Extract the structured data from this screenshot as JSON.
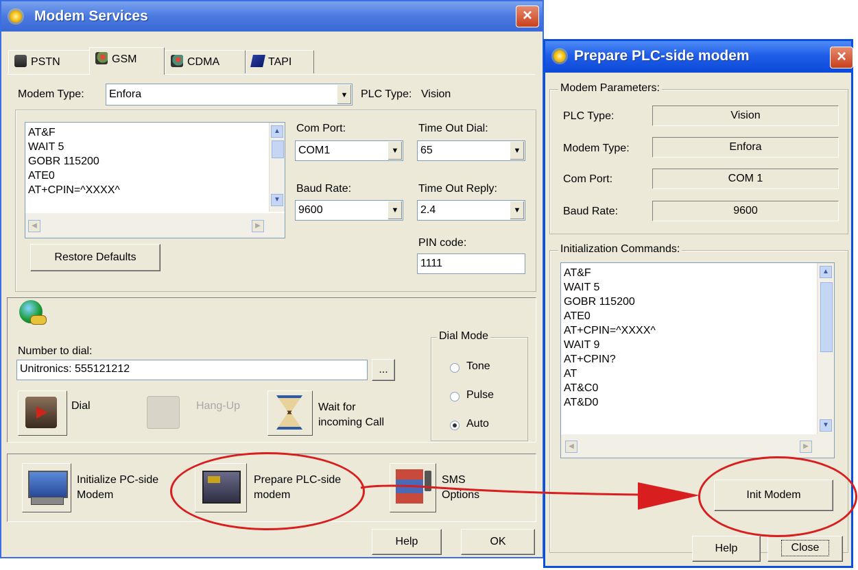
{
  "modem_services": {
    "title": "Modem Services",
    "close_glyph": "×",
    "tabs": [
      {
        "label": "PSTN"
      },
      {
        "label": "GSM"
      },
      {
        "label": "CDMA"
      },
      {
        "label": "TAPI"
      }
    ],
    "modem_type_label": "Modem Type:",
    "modem_type_value": "Enfora",
    "plc_type_label": "PLC Type:",
    "plc_type_value": "Vision",
    "init_commands": [
      "AT&F",
      "WAIT 5",
      "GOBR 115200",
      "ATE0",
      "AT+CPIN=^XXXX^"
    ],
    "com_port_label": "Com Port:",
    "com_port_value": "COM1",
    "time_out_dial_label": "Time Out Dial:",
    "time_out_dial_value": "65",
    "baud_rate_label": "Baud Rate:",
    "baud_rate_value": "9600",
    "time_out_reply_label": "Time Out Reply:",
    "time_out_reply_value": "2.4",
    "pin_code_label": "PIN code:",
    "pin_code_value": "1111",
    "restore_defaults_label": "Restore Defaults",
    "number_to_dial_label": "Number to dial:",
    "number_to_dial_value": "Unitronics: 555121212",
    "browse_label": "...",
    "dial_label": "Dial",
    "hang_up_label": "Hang-Up",
    "wait_call_label_1": "Wait for",
    "wait_call_label_2": "incoming Call",
    "dial_mode_title": "Dial Mode",
    "dial_modes": [
      {
        "label": "Tone",
        "selected": false
      },
      {
        "label": "Pulse",
        "selected": false
      },
      {
        "label": "Auto",
        "selected": true
      }
    ],
    "init_pc_label_1": "Initialize PC-side",
    "init_pc_label_2": "Modem",
    "prepare_plc_label_1": "Prepare PLC-side",
    "prepare_plc_label_2": "modem",
    "sms_label_1": "SMS",
    "sms_label_2": "Options",
    "help_label": "Help",
    "ok_label": "OK"
  },
  "prepare_plc": {
    "title": "Prepare PLC-side modem",
    "close_glyph": "×",
    "params_title": "Modem Parameters:",
    "params": [
      {
        "label": "PLC Type:",
        "value": "Vision"
      },
      {
        "label": "Modem Type:",
        "value": "Enfora"
      },
      {
        "label": "Com Port:",
        "value": "COM 1"
      },
      {
        "label": "Baud Rate:",
        "value": "9600"
      }
    ],
    "init_title": "Initialization Commands:",
    "init_commands": [
      "AT&F",
      "WAIT 5",
      "GOBR 115200",
      "ATE0",
      "AT+CPIN=^XXXX^",
      "WAIT 9",
      "AT+CPIN?",
      "AT",
      "AT&C0",
      "AT&D0"
    ],
    "init_modem_label": "Init Modem",
    "help_label": "Help",
    "close_label": "Close"
  },
  "colors": {
    "accent_blue": "#0a50e0",
    "annotation_red": "#d81e1e",
    "window_bg": "#ece9d8"
  }
}
